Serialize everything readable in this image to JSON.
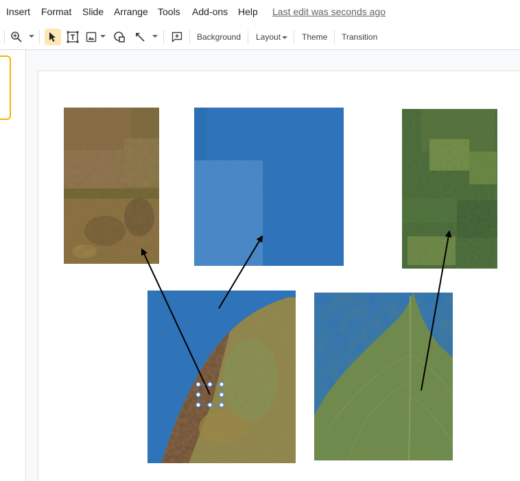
{
  "menu": {
    "items": [
      "Insert",
      "Format",
      "Slide",
      "Arrange",
      "Tools",
      "Add-ons",
      "Help"
    ],
    "last_edit": "Last edit was seconds ago"
  },
  "toolbar": {
    "background": "Background",
    "layout": "Layout",
    "theme": "Theme",
    "transition": "Transition"
  },
  "icons": [
    "zoom-icon",
    "select-cursor-icon",
    "text-box-icon",
    "image-icon",
    "shape-icon",
    "line-icon",
    "comment-icon"
  ],
  "colors": {
    "accent_active": "#fde8b5",
    "thumb_border": "#f4b400",
    "leaf_background_blue": "#2e72b7"
  }
}
